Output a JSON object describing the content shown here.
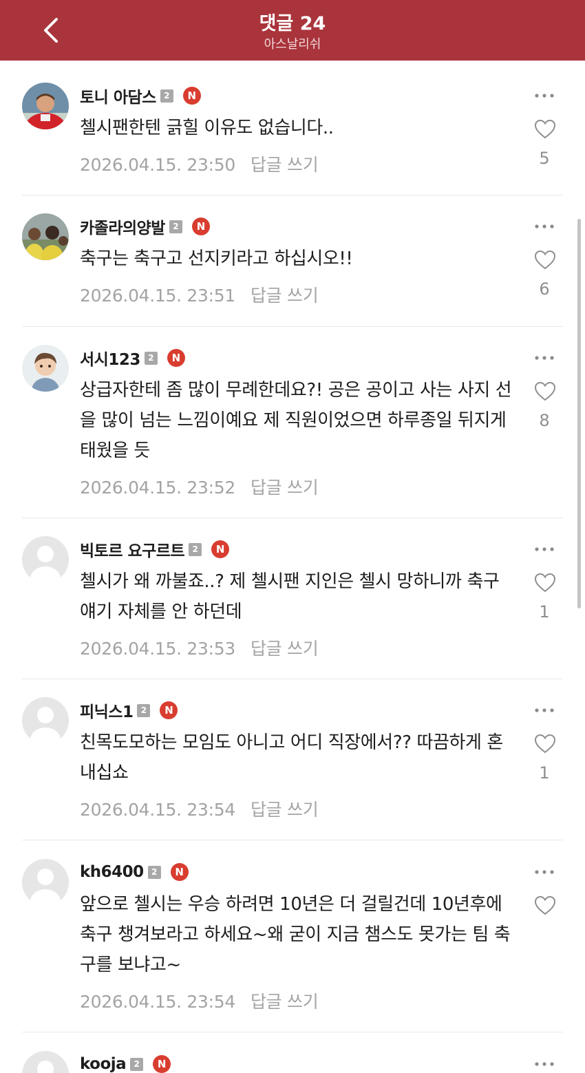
{
  "header": {
    "title": "댓글 24",
    "subtitle": "아스날리쉬"
  },
  "comments": [
    {
      "name": "토니 아담스",
      "level": "2",
      "badge": "N",
      "text": "첼시팬한텐 긁힐 이유도 없습니다..",
      "date": "2026.04.15. 23:50",
      "reply": "답글 쓰기",
      "likes": "5"
    },
    {
      "name": "카졸라의양발",
      "level": "2",
      "badge": "N",
      "text": "축구는 축구고 선지키라고 하십시오!!",
      "date": "2026.04.15. 23:51",
      "reply": "답글 쓰기",
      "likes": "6"
    },
    {
      "name": "서시123",
      "level": "2",
      "badge": "N",
      "text": "상급자한테 좀 많이 무례한데요?! 공은 공이고 사는 사지 선을 많이 넘는 느낌이예요 제 직원이었으면 하루종일 뒤지게 태웠을 듯",
      "date": "2026.04.15. 23:52",
      "reply": "답글 쓰기",
      "likes": "8"
    },
    {
      "name": "빅토르 요구르트",
      "level": "2",
      "badge": "N",
      "text": "첼시가 왜 까불죠..? 제 첼시팬 지인은 첼시 망하니까 축구 얘기 자체를 안 하던데",
      "date": "2026.04.15. 23:53",
      "reply": "답글 쓰기",
      "likes": "1"
    },
    {
      "name": "피닉스1",
      "level": "2",
      "badge": "N",
      "text": "친목도모하는 모임도 아니고 어디 직장에서?? 따끔하게 혼내십쇼",
      "date": "2026.04.15. 23:54",
      "reply": "답글 쓰기",
      "likes": "1"
    },
    {
      "name": "kh6400",
      "level": "2",
      "badge": "N",
      "text": "앞으로 첼시는 우승 하려면 10년은 더 걸릴건데 10년후에 축구 챙겨보라고 하세요~왜 굳이 지금 챔스도 못가는 팀 축구를 보냐고~",
      "date": "2026.04.15. 23:54",
      "reply": "답글 쓰기",
      "likes": ""
    },
    {
      "name": "kooja",
      "level": "2",
      "badge": "N",
      "text": "",
      "date": "",
      "reply": "",
      "likes": ""
    }
  ]
}
